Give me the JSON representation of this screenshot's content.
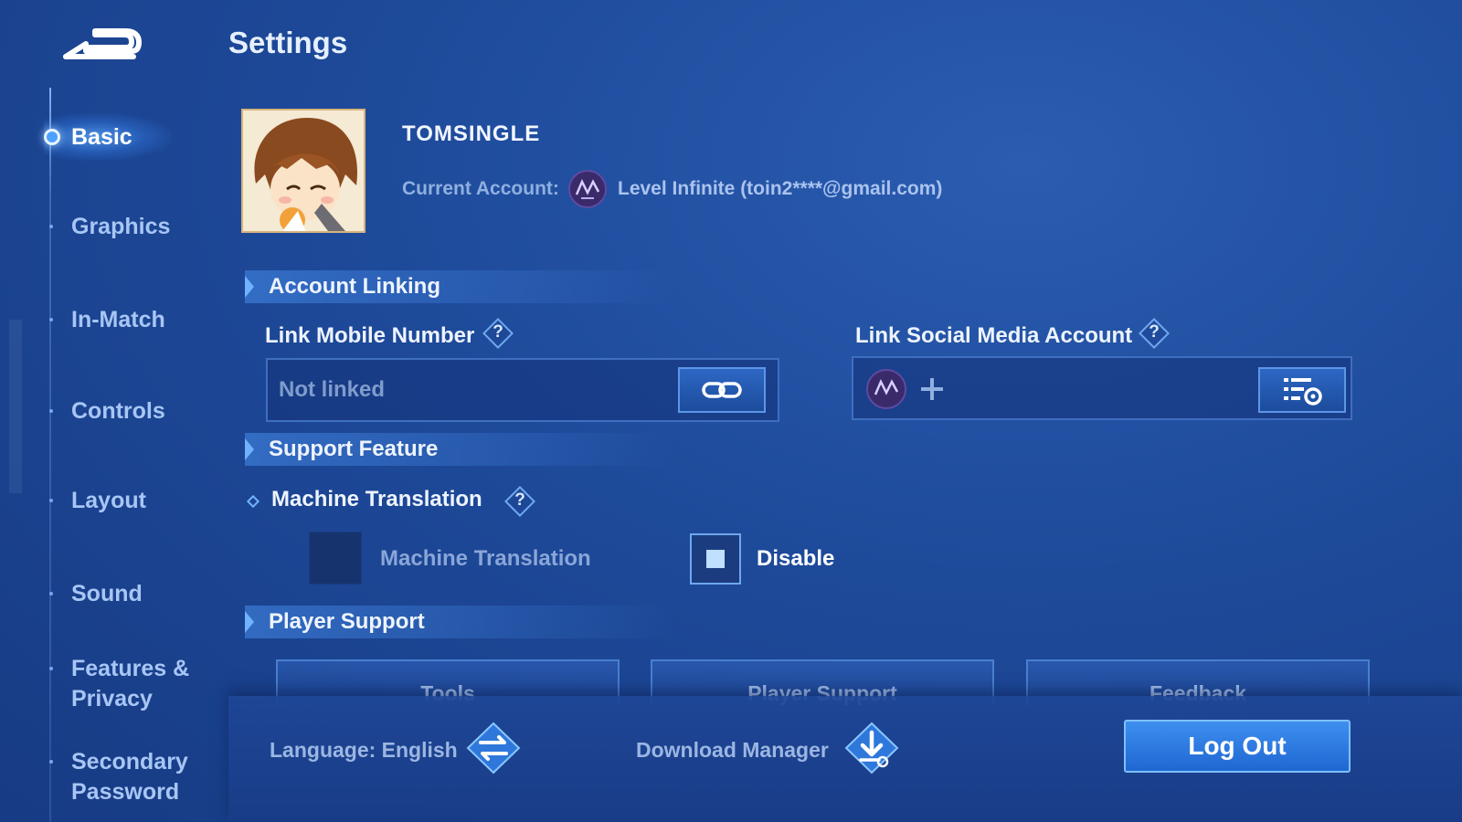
{
  "header": {
    "title": "Settings"
  },
  "sidebar": {
    "items": [
      {
        "label": "Basic",
        "active": true
      },
      {
        "label": "Graphics"
      },
      {
        "label": "In-Match"
      },
      {
        "label": "Controls"
      },
      {
        "label": "Layout"
      },
      {
        "label": "Sound"
      },
      {
        "label": "Features &",
        "label2": "Privacy"
      },
      {
        "label": "Secondary",
        "label2": "Password"
      }
    ]
  },
  "profile": {
    "username": "TOMSINGLE",
    "current_account_label": "Current Account:",
    "current_account_value": "Level Infinite (toin2****@gmail.com)"
  },
  "account_linking": {
    "title": "Account Linking",
    "mobile": {
      "label": "Link Mobile Number",
      "placeholder": "Not linked"
    },
    "social": {
      "label": "Link Social Media Account"
    }
  },
  "support_feature": {
    "title": "Support Feature",
    "machine_translation": {
      "label": "Machine Translation",
      "option_on_label": "Machine Translation",
      "option_off_label": "Disable",
      "selected": "Disable"
    }
  },
  "player_support": {
    "title": "Player Support",
    "tabs": [
      "Tools",
      "Player Support",
      "Feedback"
    ]
  },
  "footer": {
    "language": "Language: English",
    "download_manager": "Download Manager",
    "logout": "Log Out"
  },
  "colors": {
    "accent": "#3e8ff0",
    "background": "#1e4a9a",
    "text": "#eef4ff"
  },
  "icons": [
    "back-arrow-icon",
    "help-icon",
    "link-chain-icon",
    "level-infinite-logo",
    "plus-icon",
    "settings-list-icon",
    "language-swap-icon",
    "download-icon"
  ]
}
